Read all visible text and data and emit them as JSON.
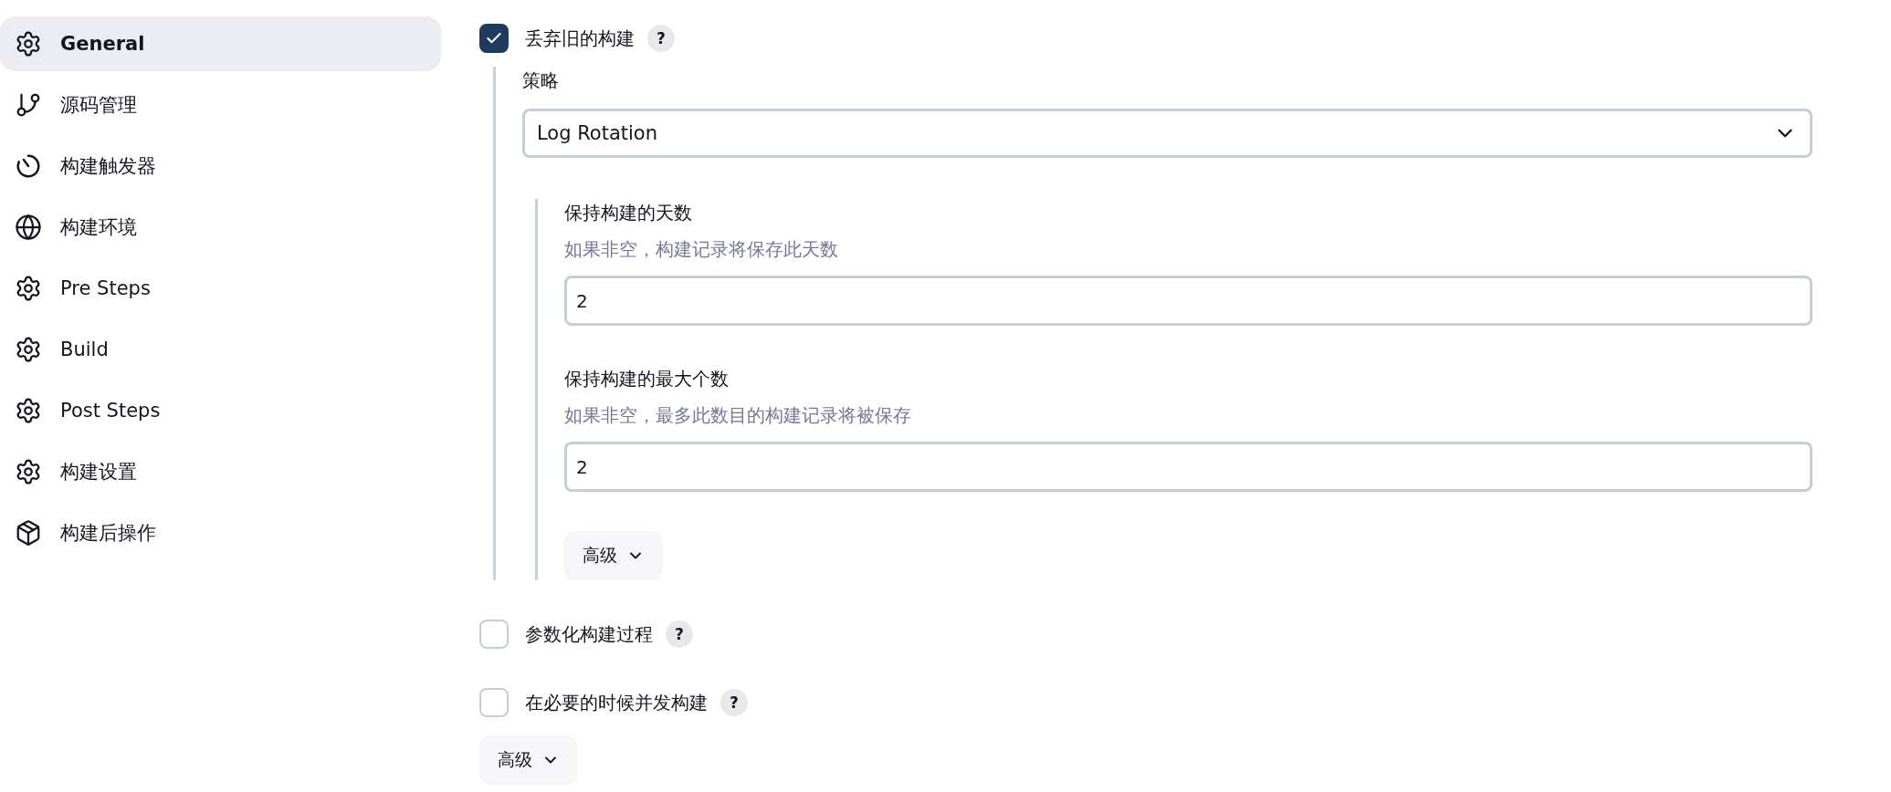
{
  "sidebar": {
    "items": [
      {
        "label": "General",
        "kind": "gear",
        "selected": true
      },
      {
        "label": "源码管理",
        "kind": "branch",
        "selected": false
      },
      {
        "label": "构建触发器",
        "kind": "timer",
        "selected": false
      },
      {
        "label": "构建环境",
        "kind": "globe",
        "selected": false
      },
      {
        "label": "Pre Steps",
        "kind": "gear",
        "selected": false
      },
      {
        "label": "Build",
        "kind": "gear",
        "selected": false
      },
      {
        "label": "Post Steps",
        "kind": "gear",
        "selected": false
      },
      {
        "label": "构建设置",
        "kind": "gear",
        "selected": false
      },
      {
        "label": "构建后操作",
        "kind": "package",
        "selected": false
      }
    ]
  },
  "discard_old_builds": {
    "label": "丢弃旧的构建",
    "checked": true,
    "help": "?",
    "strategy": {
      "label": "策略",
      "value": "Log Rotation"
    },
    "fields": [
      {
        "label": "保持构建的天数",
        "hint": "如果非空，构建记录将保存此天数",
        "value": "2"
      },
      {
        "label": "保持构建的最大个数",
        "hint": "如果非空，最多此数目的构建记录将被保存",
        "value": "2"
      }
    ],
    "advanced": "高级"
  },
  "options": [
    {
      "label": "参数化构建过程",
      "checked": false,
      "help": "?"
    },
    {
      "label": "在必要的时候并发构建",
      "checked": false,
      "help": "?"
    }
  ],
  "advanced": "高级"
}
